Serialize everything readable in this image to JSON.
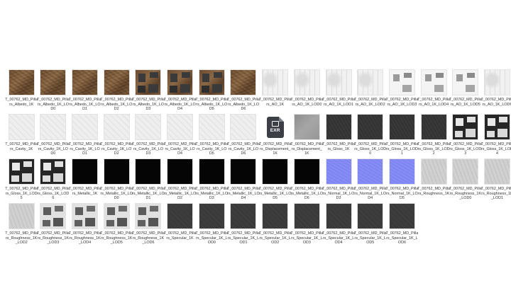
{
  "folder": {
    "view": "large-icons",
    "items": [
      {
        "name": "T_00762_MD_Pillars_Albedo_1K",
        "kind": "albedo"
      },
      {
        "name": "T_00762_MD_Pillars_Albedo_1K_LOD0",
        "kind": "albedo"
      },
      {
        "name": "T_00762_MD_Pillars_Albedo_1K_LOD1",
        "kind": "albedo"
      },
      {
        "name": "T_00762_MD_Pillars_Albedo_1K_LOD2",
        "kind": "albedo"
      },
      {
        "name": "T_00762_MD_Pillars_Albedo_1K_LOD3",
        "kind": "albedo cut"
      },
      {
        "name": "T_00762_MD_Pillars_Albedo_1K_LOD4",
        "kind": "albedo cut"
      },
      {
        "name": "T_00762_MD_Pillars_Albedo_1K_LOD5",
        "kind": "albedo cut"
      },
      {
        "name": "T_00762_MD_Pillars_Albedo_1K_LOD6",
        "kind": "albedo"
      },
      {
        "name": "T_00762_MD_Pillars_AO_1K",
        "kind": "ao"
      },
      {
        "name": "T_00762_MD_Pillars_AO_1K_LOD0",
        "kind": "ao"
      },
      {
        "name": "T_00762_MD_Pillars_AO_1K_LOD1",
        "kind": "ao"
      },
      {
        "name": "T_00762_MD_Pillars_AO_1K_LOD2",
        "kind": "ao"
      },
      {
        "name": "T_00762_MD_Pillars_AO_1K_LOD3",
        "kind": "ao cut"
      },
      {
        "name": "T_00762_MD_Pillars_AO_1K_LOD4",
        "kind": "ao cut"
      },
      {
        "name": "T_00762_MD_Pillars_AO_1K_LOD5",
        "kind": "ao cut"
      },
      {
        "name": "T_00762_MD_Pillars_AO_1K_LOD6",
        "kind": "ao"
      },
      {
        "name": "T_00762_MD_Pillars_Cavity_1K",
        "kind": "cavity"
      },
      {
        "name": "T_00762_MD_Pillars_Cavity_1K_LOD0",
        "kind": "cavity"
      },
      {
        "name": "T_00762_MD_Pillars_Cavity_1K_LOD1",
        "kind": "cavity"
      },
      {
        "name": "T_00762_MD_Pillars_Cavity_1K_LOD2",
        "kind": "cavity"
      },
      {
        "name": "T_00762_MD_Pillars_Cavity_1K_LOD3",
        "kind": "cavity"
      },
      {
        "name": "T_00762_MD_Pillars_Cavity_1K_LOD4",
        "kind": "cavity"
      },
      {
        "name": "T_00762_MD_Pillars_Cavity_1K_LOD5",
        "kind": "cavity"
      },
      {
        "name": "T_00762_MD_Pillars_Cavity_1K_LOD6",
        "kind": "cavity"
      },
      {
        "name": "T_00762_MD_Pillars_Displacement_1K",
        "kind": "file",
        "file_icon": "EXR"
      },
      {
        "name": "T_00762_MD_Pillars_Displacement_1K",
        "kind": "disp"
      },
      {
        "name": "T_00762_MD_Pillars_Gloss_1K",
        "kind": "gloss"
      },
      {
        "name": "T_00762_MD_Pillars_Gloss_1K_LOD0",
        "kind": "gloss"
      },
      {
        "name": "T_00762_MD_Pillars_Gloss_1K_LOD1",
        "kind": "gloss"
      },
      {
        "name": "T_00762_MD_Pillars_Gloss_1K_LOD2",
        "kind": "gloss"
      },
      {
        "name": "T_00762_MD_Pillars_Gloss_1K_LOD3",
        "kind": "gloss cut"
      },
      {
        "name": "T_00762_MD_Pillars_Gloss_1K_LOD4",
        "kind": "gloss cut"
      },
      {
        "name": "T_00762_MD_Pillars_Gloss_1K_LOD5",
        "kind": "gloss cut"
      },
      {
        "name": "T_00762_MD_Pillars_Gloss_1K_LOD6",
        "kind": "gloss cut"
      },
      {
        "name": "T_00762_MD_Pillars_Metallic_1K",
        "kind": "metal"
      },
      {
        "name": "T_00762_MD_Pillars_Metallic_1K_LOD0",
        "kind": "metal"
      },
      {
        "name": "T_00762_MD_Pillars_Metallic_1K_LOD1",
        "kind": "metal"
      },
      {
        "name": "T_00762_MD_Pillars_Metallic_1K_LOD2",
        "kind": "metal"
      },
      {
        "name": "T_00762_MD_Pillars_Metallic_1K_LOD3",
        "kind": "metal"
      },
      {
        "name": "T_00762_MD_Pillars_Metallic_1K_LOD4",
        "kind": "metal"
      },
      {
        "name": "T_00762_MD_Pillars_Metallic_1K_LOD5",
        "kind": "metal"
      },
      {
        "name": "T_00762_MD_Pillars_Metallic_1K_LOD6",
        "kind": "metal"
      },
      {
        "name": "T_00762_MD_Pillars_Normal_1K_LOD3",
        "kind": "normal"
      },
      {
        "name": "T_00762_MD_Pillars_Normal_1K_LOD4",
        "kind": "normal"
      },
      {
        "name": "T_00762_MD_Pillars_Normal_1K_LOD5",
        "kind": "normal"
      },
      {
        "name": "T_00762_MD_Pillars_Roughness_1K",
        "kind": "rough"
      },
      {
        "name": "T_00762_MD_Pillars_Roughness_1K_LOD0",
        "kind": "rough"
      },
      {
        "name": "T_00762_MD_Pillars_Roughness_1K_LOD1",
        "kind": "rough"
      },
      {
        "name": "T_00762_MD_Pillars_Roughness_1K_LOD2",
        "kind": "rough"
      },
      {
        "name": "T_00762_MD_Pillars_Roughness_1K_LOD3",
        "kind": "rough cut"
      },
      {
        "name": "T_00762_MD_Pillars_Roughness_1K_LOD4",
        "kind": "rough cut"
      },
      {
        "name": "T_00762_MD_Pillars_Roughness_1K_LOD5",
        "kind": "rough cut"
      },
      {
        "name": "T_00762_MD_Pillars_Roughness_1K_LOD6",
        "kind": "rough cut"
      },
      {
        "name": "T_00762_MD_Pillars_Specular_1K",
        "kind": "spec"
      },
      {
        "name": "T_00762_MD_Pillars_Specular_1K_LOD0",
        "kind": "spec"
      },
      {
        "name": "T_00762_MD_Pillars_Specular_1K_LOD1",
        "kind": "spec"
      },
      {
        "name": "T_00762_MD_Pillars_Specular_1K_LOD2",
        "kind": "spec"
      },
      {
        "name": "T_00762_MD_Pillars_Specular_1K_LOD3",
        "kind": "spec"
      },
      {
        "name": "T_00762_MD_Pillars_Specular_1K_LOD4",
        "kind": "spec"
      },
      {
        "name": "T_00762_MD_Pillars_Specular_1K_LOD5",
        "kind": "spec"
      },
      {
        "name": "T_00762_MD_Pillars_Specular_1K_LOD6",
        "kind": "spec"
      }
    ]
  }
}
